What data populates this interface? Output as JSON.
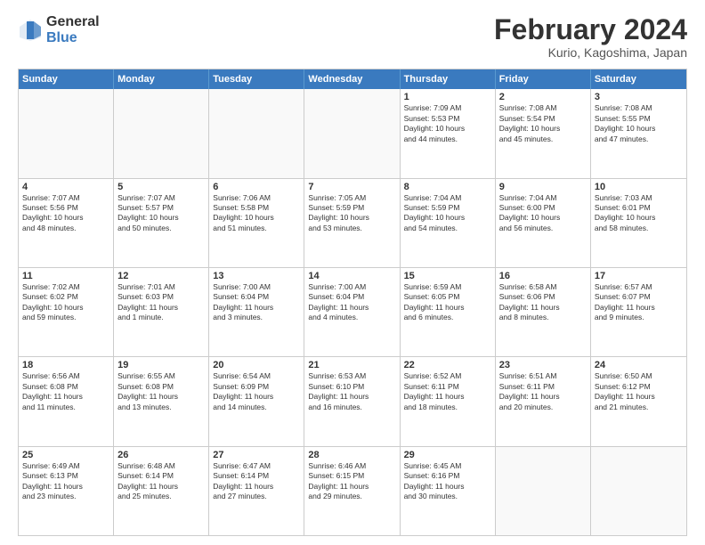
{
  "logo": {
    "general": "General",
    "blue": "Blue"
  },
  "title": "February 2024",
  "subtitle": "Kurio, Kagoshima, Japan",
  "headers": [
    "Sunday",
    "Monday",
    "Tuesday",
    "Wednesday",
    "Thursday",
    "Friday",
    "Saturday"
  ],
  "weeks": [
    [
      {
        "day": "",
        "info": ""
      },
      {
        "day": "",
        "info": ""
      },
      {
        "day": "",
        "info": ""
      },
      {
        "day": "",
        "info": ""
      },
      {
        "day": "1",
        "info": "Sunrise: 7:09 AM\nSunset: 5:53 PM\nDaylight: 10 hours\nand 44 minutes."
      },
      {
        "day": "2",
        "info": "Sunrise: 7:08 AM\nSunset: 5:54 PM\nDaylight: 10 hours\nand 45 minutes."
      },
      {
        "day": "3",
        "info": "Sunrise: 7:08 AM\nSunset: 5:55 PM\nDaylight: 10 hours\nand 47 minutes."
      }
    ],
    [
      {
        "day": "4",
        "info": "Sunrise: 7:07 AM\nSunset: 5:56 PM\nDaylight: 10 hours\nand 48 minutes."
      },
      {
        "day": "5",
        "info": "Sunrise: 7:07 AM\nSunset: 5:57 PM\nDaylight: 10 hours\nand 50 minutes."
      },
      {
        "day": "6",
        "info": "Sunrise: 7:06 AM\nSunset: 5:58 PM\nDaylight: 10 hours\nand 51 minutes."
      },
      {
        "day": "7",
        "info": "Sunrise: 7:05 AM\nSunset: 5:59 PM\nDaylight: 10 hours\nand 53 minutes."
      },
      {
        "day": "8",
        "info": "Sunrise: 7:04 AM\nSunset: 5:59 PM\nDaylight: 10 hours\nand 54 minutes."
      },
      {
        "day": "9",
        "info": "Sunrise: 7:04 AM\nSunset: 6:00 PM\nDaylight: 10 hours\nand 56 minutes."
      },
      {
        "day": "10",
        "info": "Sunrise: 7:03 AM\nSunset: 6:01 PM\nDaylight: 10 hours\nand 58 minutes."
      }
    ],
    [
      {
        "day": "11",
        "info": "Sunrise: 7:02 AM\nSunset: 6:02 PM\nDaylight: 10 hours\nand 59 minutes."
      },
      {
        "day": "12",
        "info": "Sunrise: 7:01 AM\nSunset: 6:03 PM\nDaylight: 11 hours\nand 1 minute."
      },
      {
        "day": "13",
        "info": "Sunrise: 7:00 AM\nSunset: 6:04 PM\nDaylight: 11 hours\nand 3 minutes."
      },
      {
        "day": "14",
        "info": "Sunrise: 7:00 AM\nSunset: 6:04 PM\nDaylight: 11 hours\nand 4 minutes."
      },
      {
        "day": "15",
        "info": "Sunrise: 6:59 AM\nSunset: 6:05 PM\nDaylight: 11 hours\nand 6 minutes."
      },
      {
        "day": "16",
        "info": "Sunrise: 6:58 AM\nSunset: 6:06 PM\nDaylight: 11 hours\nand 8 minutes."
      },
      {
        "day": "17",
        "info": "Sunrise: 6:57 AM\nSunset: 6:07 PM\nDaylight: 11 hours\nand 9 minutes."
      }
    ],
    [
      {
        "day": "18",
        "info": "Sunrise: 6:56 AM\nSunset: 6:08 PM\nDaylight: 11 hours\nand 11 minutes."
      },
      {
        "day": "19",
        "info": "Sunrise: 6:55 AM\nSunset: 6:08 PM\nDaylight: 11 hours\nand 13 minutes."
      },
      {
        "day": "20",
        "info": "Sunrise: 6:54 AM\nSunset: 6:09 PM\nDaylight: 11 hours\nand 14 minutes."
      },
      {
        "day": "21",
        "info": "Sunrise: 6:53 AM\nSunset: 6:10 PM\nDaylight: 11 hours\nand 16 minutes."
      },
      {
        "day": "22",
        "info": "Sunrise: 6:52 AM\nSunset: 6:11 PM\nDaylight: 11 hours\nand 18 minutes."
      },
      {
        "day": "23",
        "info": "Sunrise: 6:51 AM\nSunset: 6:11 PM\nDaylight: 11 hours\nand 20 minutes."
      },
      {
        "day": "24",
        "info": "Sunrise: 6:50 AM\nSunset: 6:12 PM\nDaylight: 11 hours\nand 21 minutes."
      }
    ],
    [
      {
        "day": "25",
        "info": "Sunrise: 6:49 AM\nSunset: 6:13 PM\nDaylight: 11 hours\nand 23 minutes."
      },
      {
        "day": "26",
        "info": "Sunrise: 6:48 AM\nSunset: 6:14 PM\nDaylight: 11 hours\nand 25 minutes."
      },
      {
        "day": "27",
        "info": "Sunrise: 6:47 AM\nSunset: 6:14 PM\nDaylight: 11 hours\nand 27 minutes."
      },
      {
        "day": "28",
        "info": "Sunrise: 6:46 AM\nSunset: 6:15 PM\nDaylight: 11 hours\nand 29 minutes."
      },
      {
        "day": "29",
        "info": "Sunrise: 6:45 AM\nSunset: 6:16 PM\nDaylight: 11 hours\nand 30 minutes."
      },
      {
        "day": "",
        "info": ""
      },
      {
        "day": "",
        "info": ""
      }
    ]
  ]
}
